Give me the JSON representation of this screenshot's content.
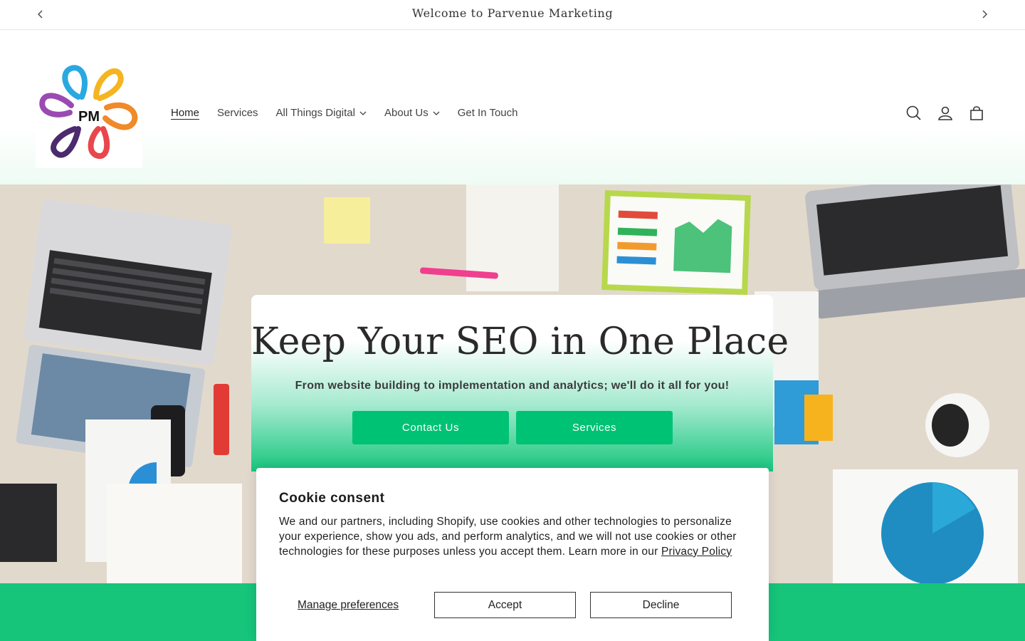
{
  "announcement": {
    "text": "Welcome to Parvenue Marketing",
    "prev_icon": "chevron-left-icon",
    "next_icon": "chevron-right-icon"
  },
  "header": {
    "logo_text": "PM",
    "nav": [
      {
        "label": "Home",
        "active": true,
        "dropdown": false
      },
      {
        "label": "Services",
        "active": false,
        "dropdown": false
      },
      {
        "label": "All Things Digital",
        "active": false,
        "dropdown": true
      },
      {
        "label": "About Us",
        "active": false,
        "dropdown": true
      },
      {
        "label": "Get In Touch",
        "active": false,
        "dropdown": false
      }
    ],
    "icons": [
      "search-icon",
      "account-icon",
      "cart-icon"
    ]
  },
  "hero": {
    "title": "Keep Your SEO in One Place",
    "subtitle": "From website building to implementation and analytics; we'll do it all for you!",
    "buttons": {
      "contact": "Contact Us",
      "services": "Services"
    }
  },
  "cookie": {
    "title": "Cookie consent",
    "body": "We and our partners, including Shopify, use cookies and other technologies to personalize your experience, show you ads, and perform analytics, and we will not use cookies or other technologies for these purposes unless you accept them. Learn more in our ",
    "link": "Privacy Policy",
    "manage": "Manage preferences",
    "accept": "Accept",
    "decline": "Decline"
  },
  "colors": {
    "accent_green": "#00c274",
    "band_green": "#16c47a"
  }
}
